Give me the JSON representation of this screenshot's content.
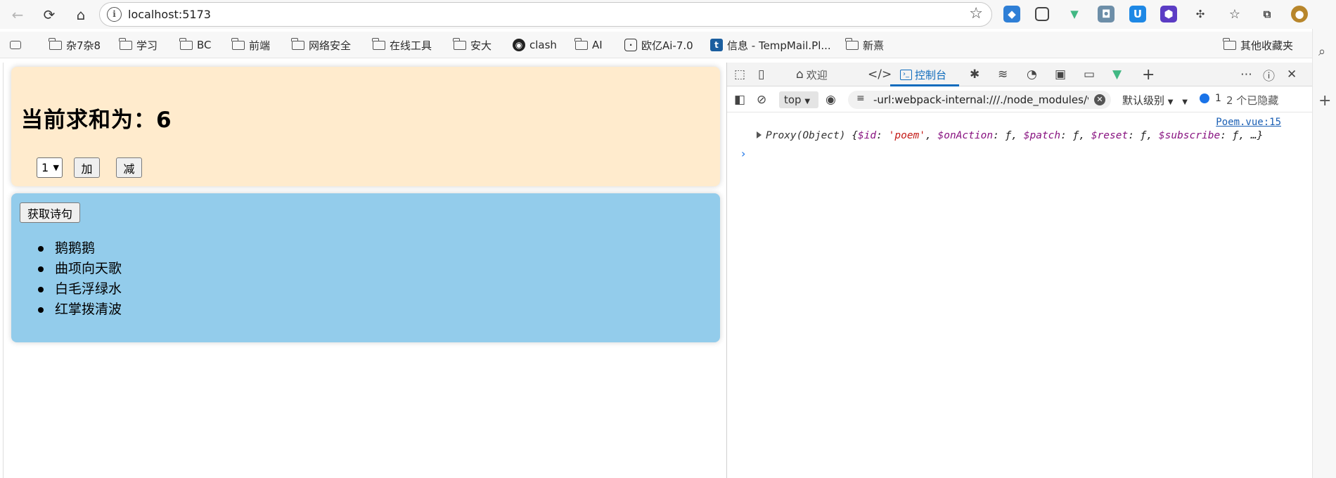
{
  "browser": {
    "url": "localhost:5173",
    "bookmarks": [
      {
        "label": "杂7杂8",
        "icon": "folder-icon"
      },
      {
        "label": "学习",
        "icon": "folder-icon"
      },
      {
        "label": "BC",
        "icon": "folder-icon"
      },
      {
        "label": "前端",
        "icon": "folder-icon"
      },
      {
        "label": "网络安全",
        "icon": "folder-icon"
      },
      {
        "label": "在线工具",
        "icon": "folder-icon"
      },
      {
        "label": "安大",
        "icon": "folder-icon"
      },
      {
        "label": "clash",
        "icon": "github-icon"
      },
      {
        "label": "AI",
        "icon": "folder-icon"
      },
      {
        "label": "欧亿Ai-7.0",
        "icon": "chat-icon"
      },
      {
        "label": "信息 - TempMail.Pl...",
        "icon": "tempmail-icon"
      },
      {
        "label": "新熹",
        "icon": "folder-icon"
      }
    ],
    "other_bookmarks": "其他收藏夹"
  },
  "page": {
    "sum_title": "当前求和为：6",
    "select_value": "1",
    "add_label": "加",
    "sub_label": "减",
    "poem_button": "获取诗句",
    "poems": [
      "鹅鹅鹅",
      "曲项向天歌",
      "白毛浮绿水",
      "红掌拨清波"
    ]
  },
  "devtools": {
    "tab_welcome": "欢迎",
    "tab_console": "控制台",
    "context": "top",
    "filter": "-url:webpack-internal:///./node_modules/vue",
    "level": "默认级别",
    "message_count": "1",
    "hidden_count": "2 个已隐藏",
    "source_link": "Poem.vue:15",
    "log": {
      "proxy": "Proxy(Object)",
      "id_key": "$id",
      "id_value": "'poem'",
      "action_key": "$onAction",
      "patch_key": "$patch",
      "reset_key": "$reset",
      "subscribe_key": "$subscribe",
      "fn": "ƒ",
      "more": "…"
    }
  }
}
